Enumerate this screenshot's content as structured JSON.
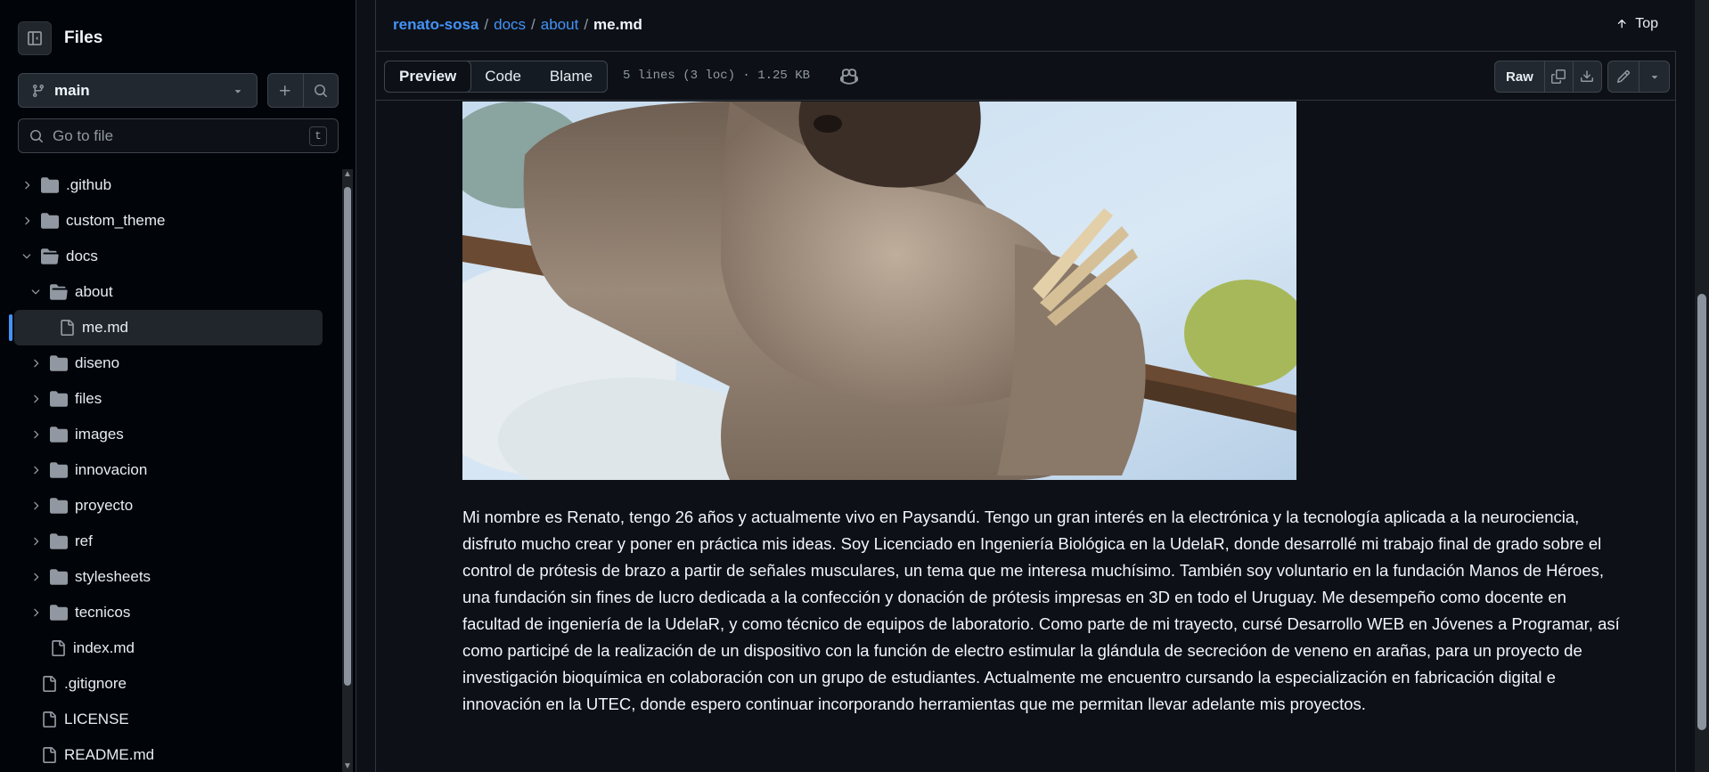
{
  "sidebar": {
    "title": "Files",
    "branch": "main",
    "search_placeholder": "Go to file",
    "search_shortcut": "t",
    "tree": [
      {
        "label": ".github",
        "type": "folder",
        "depth": 0,
        "expanded": false
      },
      {
        "label": "custom_theme",
        "type": "folder",
        "depth": 0,
        "expanded": false
      },
      {
        "label": "docs",
        "type": "folder",
        "depth": 0,
        "expanded": true
      },
      {
        "label": "about",
        "type": "folder",
        "depth": 1,
        "expanded": true
      },
      {
        "label": "me.md",
        "type": "file",
        "depth": 2,
        "selected": true
      },
      {
        "label": "diseno",
        "type": "folder",
        "depth": 1,
        "expanded": false
      },
      {
        "label": "files",
        "type": "folder",
        "depth": 1,
        "expanded": false
      },
      {
        "label": "images",
        "type": "folder",
        "depth": 1,
        "expanded": false
      },
      {
        "label": "innovacion",
        "type": "folder",
        "depth": 1,
        "expanded": false
      },
      {
        "label": "proyecto",
        "type": "folder",
        "depth": 1,
        "expanded": false
      },
      {
        "label": "ref",
        "type": "folder",
        "depth": 1,
        "expanded": false
      },
      {
        "label": "stylesheets",
        "type": "folder",
        "depth": 1,
        "expanded": false
      },
      {
        "label": "tecnicos",
        "type": "folder",
        "depth": 1,
        "expanded": false
      },
      {
        "label": "index.md",
        "type": "file",
        "depth": 1
      },
      {
        "label": ".gitignore",
        "type": "file",
        "depth": 0
      },
      {
        "label": "LICENSE",
        "type": "file",
        "depth": 0
      },
      {
        "label": "README.md",
        "type": "file",
        "depth": 0
      }
    ]
  },
  "breadcrumb": {
    "root": "renato-sosa",
    "parts": [
      "docs",
      "about"
    ],
    "current": "me.md"
  },
  "top_button": "Top",
  "file_header": {
    "tabs": [
      "Preview",
      "Code",
      "Blame"
    ],
    "active_tab": "Preview",
    "meta": "5 lines (3 loc) · 1.25 KB",
    "raw_label": "Raw"
  },
  "content": {
    "image_icon": "sloth-photo",
    "bio": "Mi nombre es Renato, tengo 26 años y actualmente vivo en Paysandú. Tengo un gran interés en la electrónica y la tecnología aplicada a la neurociencia, disfruto mucho crear y poner en práctica mis ideas. Soy Licenciado en Ingeniería Biológica en la UdelaR, donde desarrollé mi trabajo final de grado sobre el control de prótesis de brazo a partir de señales musculares, un tema que me interesa muchísimo. También soy voluntario en la fundación Manos de Héroes, una fundación sin fines de lucro dedicada a la confección y donación de prótesis impresas en 3D en todo el Uruguay. Me desempeño como docente en facultad de ingeniería de la UdelaR, y como técnico de equipos de laboratorio. Como parte de mi trayecto, cursé Desarrollo WEB en Jóvenes a Programar, así como participé de la realización de un dispositivo con la función de electro estimular la glándula de secrecióon de veneno en arañas, para un proyecto de investigación bioquímica en colaboración con un grupo de estudiantes. Actualmente me encuentro cursando la especialización en fabricación digital e innovación en la UTEC, donde espero continuar incorporando herramientas que me permitan llevar adelante mis proyectos."
  },
  "colors": {
    "background": "#0d1117",
    "sidebar_bg": "#010409",
    "accent": "#4493f8",
    "border": "#30363d",
    "muted": "#9198a1"
  }
}
